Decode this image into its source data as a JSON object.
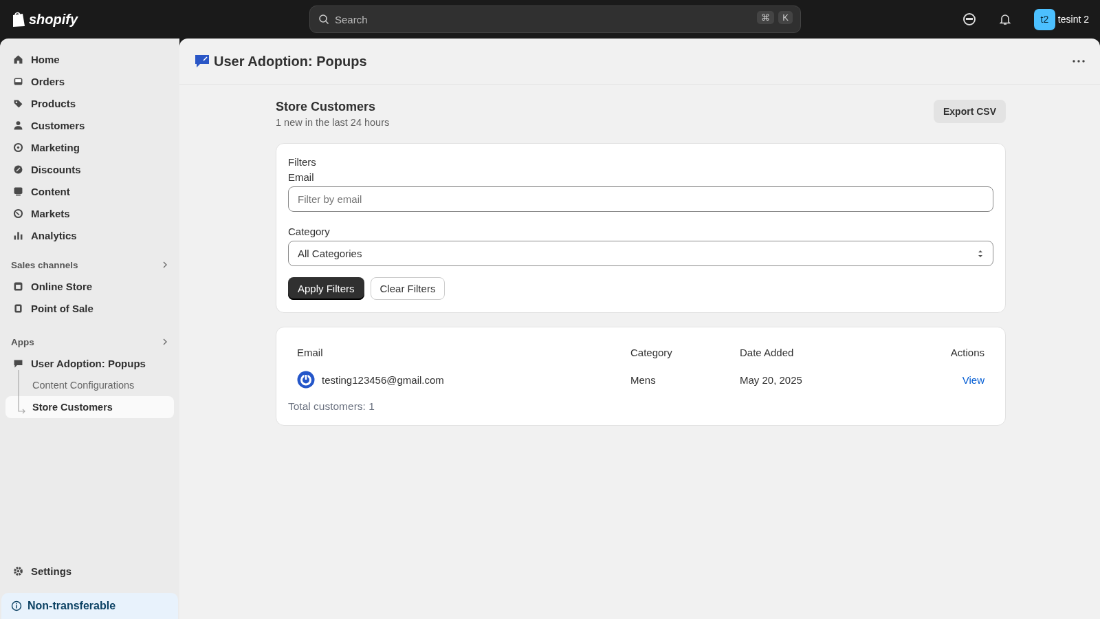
{
  "topbar": {
    "logo": "shopify",
    "search": {
      "placeholder": "Search",
      "keys": [
        "⌘",
        "K"
      ]
    },
    "user": {
      "initials": "t2",
      "name": "tesint 2"
    }
  },
  "sidebar": {
    "items": [
      {
        "label": "Home",
        "selected": false
      },
      {
        "label": "Orders",
        "selected": false
      },
      {
        "label": "Products",
        "selected": false
      },
      {
        "label": "Customers",
        "selected": false
      },
      {
        "label": "Marketing",
        "selected": false
      },
      {
        "label": "Discounts",
        "selected": false
      },
      {
        "label": "Content",
        "selected": false
      },
      {
        "label": "Markets",
        "selected": false
      },
      {
        "label": "Analytics",
        "selected": false
      }
    ],
    "sales_channels": {
      "title": "Sales channels",
      "items": [
        {
          "label": "Online Store",
          "selected": false
        },
        {
          "label": "Point of Sale",
          "selected": false
        }
      ]
    },
    "apps": {
      "title": "Apps",
      "items": [
        {
          "label": "User Adoption: Popups",
          "selected": false,
          "children": [
            {
              "label": "Content Configurations",
              "selected": false
            },
            {
              "label": "Store Customers",
              "selected": true
            }
          ]
        }
      ]
    },
    "settings": "Settings",
    "plan_notice": "Non-transferable"
  },
  "page": {
    "title": "User Adoption: Popups",
    "section_title": "Store Customers",
    "section_subtitle": "1 new in the last 24 hours",
    "export_button": "Export CSV",
    "filters": {
      "title": "Filters",
      "email_label": "Email",
      "email_placeholder": "Filter by email",
      "category_label": "Category",
      "category_value": "All Categories",
      "apply_button": "Apply Filters",
      "clear_button": "Clear Filters"
    },
    "table": {
      "columns": [
        "Email",
        "Category",
        "Date Added",
        "Actions"
      ],
      "rows": [
        {
          "email": "testing123456@gmail.com",
          "category": "Mens",
          "date": "May 20, 2025",
          "action": "View"
        }
      ],
      "total": "Total customers: 1"
    }
  }
}
